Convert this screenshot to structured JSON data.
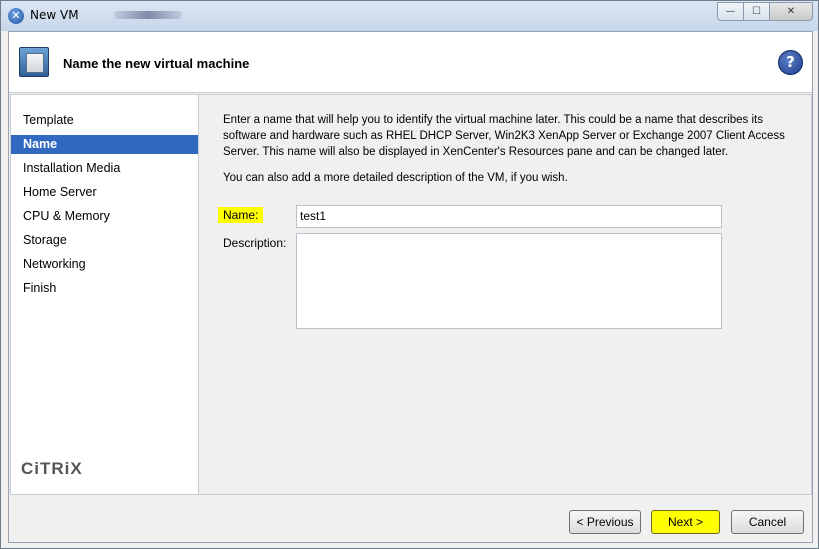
{
  "window": {
    "title": "New VM",
    "controls": {
      "minimize": "—",
      "maximize": "☐",
      "close": "✕"
    }
  },
  "header": {
    "title": "Name the new virtual machine",
    "help_icon": "?"
  },
  "sidebar": {
    "items": [
      {
        "label": "Template",
        "selected": false
      },
      {
        "label": "Name",
        "selected": true
      },
      {
        "label": "Installation Media",
        "selected": false
      },
      {
        "label": "Home Server",
        "selected": false
      },
      {
        "label": "CPU & Memory",
        "selected": false
      },
      {
        "label": "Storage",
        "selected": false
      },
      {
        "label": "Networking",
        "selected": false
      },
      {
        "label": "Finish",
        "selected": false
      }
    ],
    "logo": "CiTRiX"
  },
  "main": {
    "intro": "Enter a name that will help you to identify the virtual machine later. This could be a name that describes its software and hardware such as RHEL DHCP Server, Win2K3 XenApp Server or Exchange 2007 Client Access Server. This name will also be displayed in XenCenter's Resources pane and can be changed later.",
    "intro2": "You can also add a more detailed description of the VM, if you wish.",
    "name_label": "Name:",
    "name_value": "test1",
    "description_label": "Description:",
    "description_value": ""
  },
  "footer": {
    "previous_label": "< Previous",
    "next_label": "Next >",
    "cancel_label": "Cancel"
  },
  "colors": {
    "selection": "#3269c0",
    "highlight": "#ffff00"
  }
}
